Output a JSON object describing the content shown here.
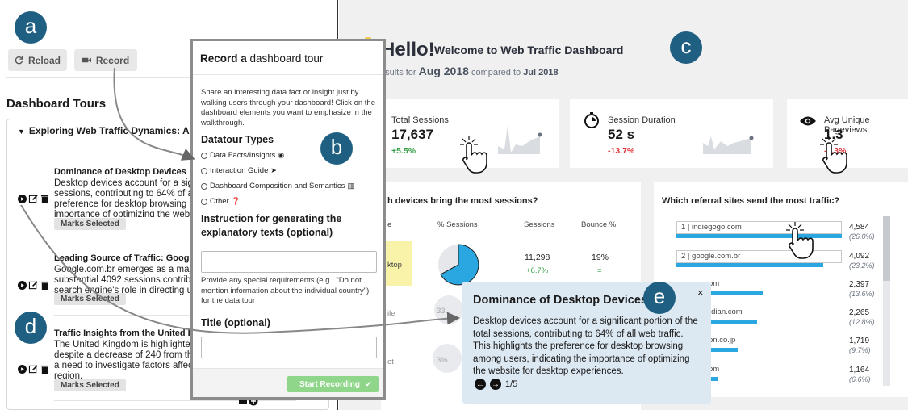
{
  "left_panel": {
    "reload_label": "Reload",
    "record_label": "Record",
    "heading": "Dashboard Tours",
    "tour_title": "Exploring Web Traffic Dynamics: A Deep",
    "entries": [
      {
        "title": "Dominance of Desktop Devices",
        "lines": [
          "Desktop devices account for a signi",
          "sessions, contributing to 64% of all",
          "preference for desktop browsing ar",
          "importance of optimizing the websi"
        ],
        "marks": "Marks Selected"
      },
      {
        "title": "Leading Source of Traffic: Google B",
        "lines": [
          "Google.com.br emerges as a major t",
          "substantial 4092 sessions contribut",
          "search engine's role in directing use"
        ],
        "marks": "Marks Selected"
      },
      {
        "title": "Traffic Insights from the United Kin",
        "lines": [
          "The United Kingdom is highlighted f",
          "despite a decrease of 240 from the",
          "a need to investigate factors affecti",
          "region."
        ],
        "marks": "Marks Selected"
      }
    ]
  },
  "modal": {
    "title_bold": "Record a",
    "title_rest": " dashboard tour",
    "description": "Share an interesting data fact or insight just by walking users through your dashboard! Click on the dashboard elements you want to emphasize in the walkthrough.",
    "types_heading": "Datatour Types",
    "types": [
      "Data Facts/Insights",
      "Interaction Guide",
      "Dashboard Composition and Semantics",
      "Other"
    ],
    "instruction_heading": "Instruction for generating the explanatory texts (optional)",
    "instruction_note": "Provide any special requirements (e.g., \"Do not mention information about the individual country\") for the data tour",
    "title_heading": "Title (optional)",
    "start_label": "Start Recording"
  },
  "dashboard": {
    "hello": "Hello!",
    "welcome": "Welcome to Web Traffic Dashboard",
    "sub_pre": "ng results for",
    "period": "Aug 2018",
    "sub_mid": "compared to",
    "compare_period": "Jul 2018",
    "kpis": [
      {
        "label": "Total Sessions",
        "value": "17,637",
        "delta": "+5.5%"
      },
      {
        "label": "Session Duration",
        "value": "52 s",
        "delta": "-13.7%"
      },
      {
        "label": "Avg Unique Pageviews",
        "value": "1.3",
        "delta": "-2.3%"
      }
    ],
    "devices_question": "h devices bring the most sessions?",
    "device_cols": [
      "e",
      "% Sessions",
      "Sessions",
      "Bounce %"
    ],
    "device_rows": [
      {
        "name": "ktop",
        "sessions": "11,298",
        "change": "+6.7%",
        "bounce": "19%",
        "bounce_change": "="
      },
      {
        "name": "ile",
        "pct": "33"
      },
      {
        "name": "et",
        "pct": "3%"
      }
    ],
    "referral_question": "Which referral sites send the most traffic?",
    "referrals": [
      {
        "rank": "1",
        "site": "indiegogo.com",
        "sessions": "4,584",
        "pct": "(26.0%)",
        "share": 1.0
      },
      {
        "rank": "2",
        "site": "google.com.br",
        "sessions": "4,092",
        "pct": "(23.2%)",
        "share": 0.89
      },
      {
        "rank": "",
        "site": "om",
        "sessions": "2,397",
        "pct": "(13.6%)",
        "share": 0.52
      },
      {
        "rank": "",
        "site": "rdian.com",
        "sessions": "2,265",
        "pct": "(12.8%)",
        "share": 0.49
      },
      {
        "rank": "",
        "site": "on.co.jp",
        "sessions": "1,719",
        "pct": "(9.7%)",
        "share": 0.37
      },
      {
        "rank": "",
        "site": "om",
        "sessions": "1,164",
        "pct": "(6.6%)",
        "share": 0.25
      }
    ]
  },
  "popup": {
    "title": "Dominance of Desktop Devices",
    "body": "Desktop devices account for a significant portion of the total sessions, contributing to 64% of all web traffic. This highlights the preference for desktop browsing among users, indicating the importance of optimizing the website for desktop experiences.",
    "close": "×",
    "page": "1/5"
  },
  "labels": {
    "a": "a",
    "b": "b",
    "c": "c",
    "d": "d",
    "e": "e"
  },
  "colors": {
    "accent_blue": "#2aa6e0",
    "label_bg": "#1e5f82",
    "positive": "#3aa14a",
    "negative": "#e0393e",
    "highlight_yellow": "#f8f3a8",
    "start_green": "#8fd68a"
  }
}
